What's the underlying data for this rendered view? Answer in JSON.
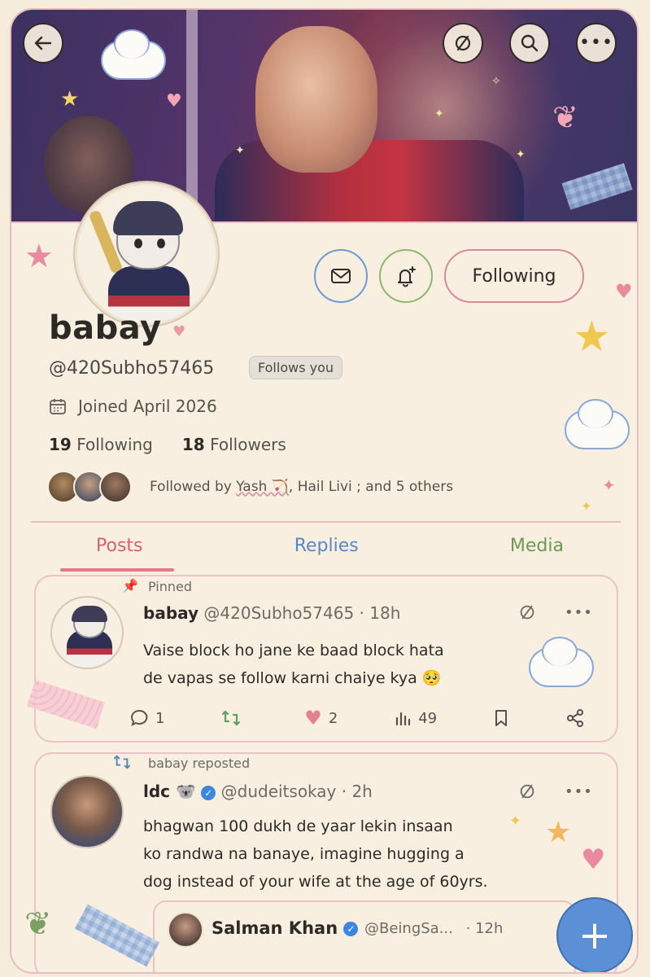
{
  "header": {
    "back_icon": "arrow-left-icon",
    "mute_icon": "slash-circle-icon",
    "search_icon": "search-icon",
    "more_icon": "more-horizontal-icon"
  },
  "profile": {
    "name": "babay",
    "handle": "@420Subho57465",
    "follows_you": "Follows you",
    "joined": "Joined April 2026",
    "following_count": "19",
    "following_label": "Following",
    "followers_count": "18",
    "followers_label": "Followers",
    "followed_by_prefix": "Followed by",
    "followed_by_1": "Yash 🏹",
    "followed_by_2": ", Hail Livi",
    "followed_by_suffix": "; and 5 others"
  },
  "actions": {
    "following_button": "Following"
  },
  "tabs": [
    "Posts",
    "Replies",
    "Media"
  ],
  "posts": [
    {
      "pinned_label": "Pinned",
      "author": "babay",
      "handle": "@420Subho57465",
      "time": "· 18h",
      "text_line1": "Vaise block ho jane ke baad block hata",
      "text_line2": "de vapas se follow karni chaiye kya 🥺",
      "replies": "1",
      "reposts": "",
      "likes": "2",
      "views": "49"
    },
    {
      "repost_label": "babay reposted",
      "author": "ldc 🐨",
      "handle": "@dudeitsokay",
      "time": "· 2h",
      "text_line1": "bhagwan 100 dukh de yaar lekin insaan",
      "text_line2": "ko randwa na banaye, imagine hugging a",
      "text_line3": "dog instead of your wife at the age of 60yrs.",
      "quote": {
        "name": "Salman Khan",
        "handle": "@BeingSa...",
        "time": "· 12h"
      }
    }
  ],
  "colors": {
    "background": "#f6ecdc",
    "border_pink": "#e8bcc0",
    "tab_posts": "#d9606b",
    "tab_replies": "#5b86c4",
    "tab_media": "#6c9a55",
    "fab": "#5b8fd6",
    "verified": "#3d86e0"
  }
}
